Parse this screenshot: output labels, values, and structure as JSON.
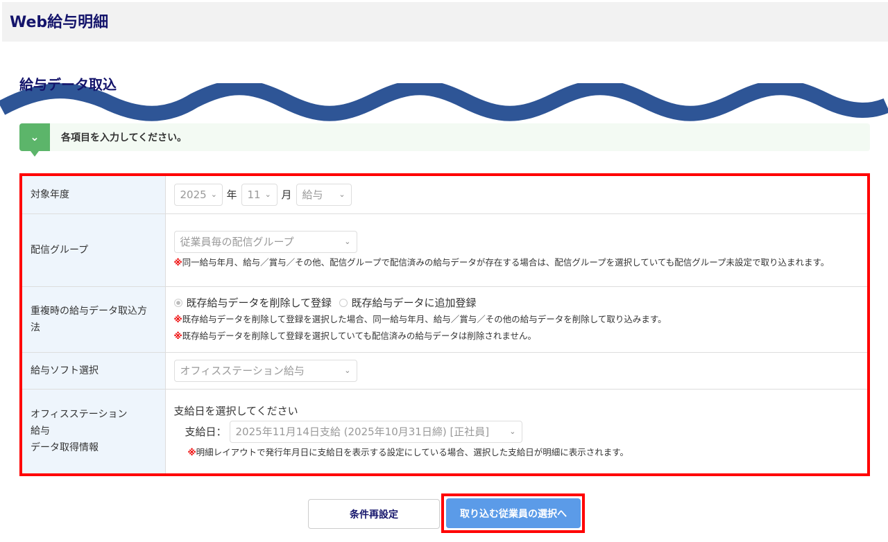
{
  "app": {
    "title": "Web給与明細"
  },
  "page": {
    "title": "給与データ取込",
    "info": "各項目を入力してください。"
  },
  "colors": {
    "navy": "#14146b",
    "wave": "#2e5596",
    "green": "#5cb56a",
    "highlight": "#ff0000",
    "primary": "#5b9be8"
  },
  "form": {
    "target": {
      "label": "対象年度",
      "year": "2025",
      "year_unit": "年",
      "month": "11",
      "month_unit": "月",
      "type": "給与"
    },
    "group": {
      "label": "配信グループ",
      "value": "従業員毎の配信グループ",
      "note_mark": "※",
      "note": "同一給与年月、給与／賞与／その他、配信グループで配信済みの給与データが存在する場合は、配信グループを選択していても配信グループ未設定で取り込まれます。"
    },
    "duplicate": {
      "label": "重複時の給与データ取込方法",
      "option1": "既存給与データを削除して登録",
      "option2": "既存給与データに追加登録",
      "note_mark": "※",
      "note1": "既存給与データを削除して登録を選択した場合、同一給与年月、給与／賞与／その他の給与データを削除して取り込みます。",
      "note2": "既存給与データを削除して登録を選択していても配信済みの給与データは削除されません。"
    },
    "software": {
      "label": "給与ソフト選択",
      "value": "オフィスステーション給与"
    },
    "os": {
      "label1": "オフィスステーション",
      "label2": "給与",
      "label3": "データ取得情報",
      "prompt": "支給日を選択してください",
      "pay_label": "支給日：",
      "pay_value": "2025年11月14日支給 (2025年10月31日締) [正社員]",
      "note_mark": "※",
      "note": "明細レイアウトで発行年月日に支給日を表示する設定にしている場合、選択した支給日が明細に表示されます。"
    }
  },
  "buttons": {
    "reset": "条件再設定",
    "next": "取り込む従業員の選択へ"
  }
}
